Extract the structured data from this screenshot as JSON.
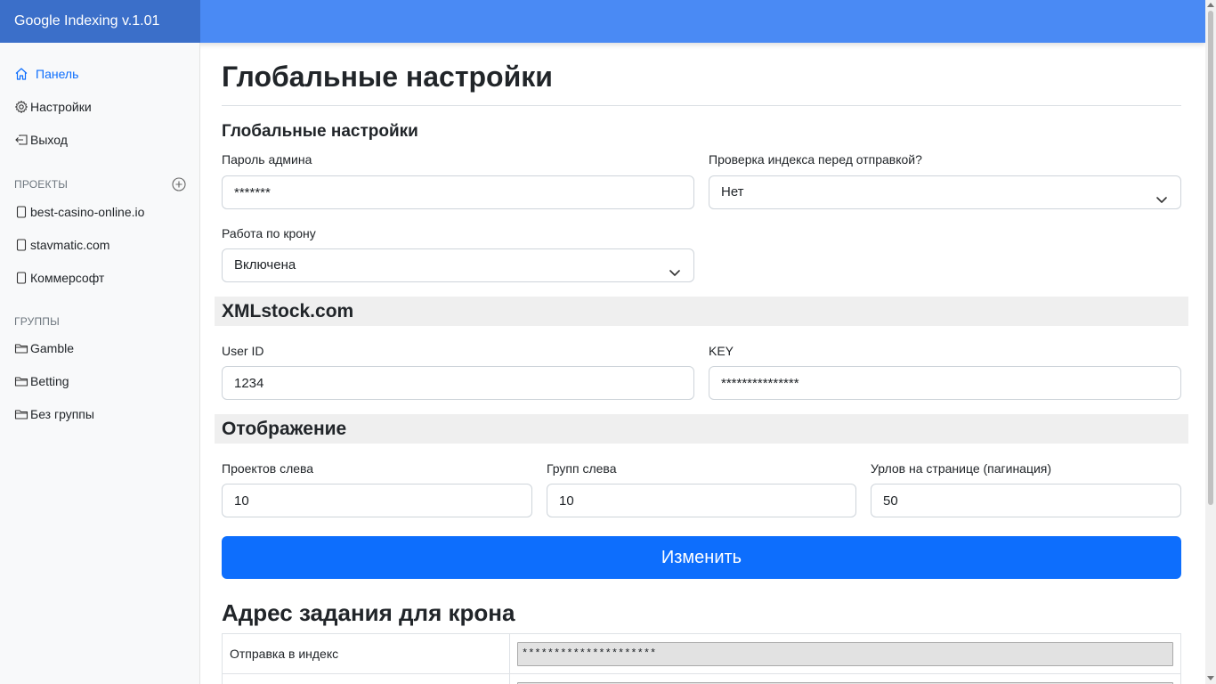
{
  "app": {
    "title": "Google Indexing v.1.01"
  },
  "sidebar": {
    "nav": [
      {
        "label": "Панель",
        "icon": "home-icon",
        "active": true
      },
      {
        "label": "Настройки",
        "icon": "gear-icon"
      },
      {
        "label": "Выход",
        "icon": "logout-icon"
      }
    ],
    "projects_heading": "ПРОЕКТЫ",
    "projects": [
      {
        "label": "best-casino-online.io"
      },
      {
        "label": "stavmatic.com"
      },
      {
        "label": "Коммерсофт"
      }
    ],
    "groups_heading": "ГРУППЫ",
    "groups": [
      {
        "label": "Gamble"
      },
      {
        "label": "Betting"
      },
      {
        "label": "Без группы"
      }
    ]
  },
  "page": {
    "title": "Глобальные настройки"
  },
  "global": {
    "heading": "Глобальные настройки",
    "admin_password_label": "Пароль админа",
    "admin_password_value": "*******",
    "index_check_label": "Проверка индекса перед отправкой?",
    "index_check_value": "Нет",
    "cron_label": "Работа по крону",
    "cron_value": "Включена"
  },
  "xmlstock": {
    "heading": "XMLstock.com",
    "user_id_label": "User ID",
    "user_id_value": "1234",
    "key_label": "KEY",
    "key_value": "***************"
  },
  "display": {
    "heading": "Отображение",
    "projects_left_label": "Проектов слева",
    "projects_left_value": "10",
    "groups_left_label": "Групп слева",
    "groups_left_value": "10",
    "urls_per_page_label": "Урлов на странице (пагинация)",
    "urls_per_page_value": "50"
  },
  "actions": {
    "submit_label": "Изменить"
  },
  "cron_section": {
    "heading": "Адрес задания для крона",
    "rows": [
      {
        "name": "Отправка в индекс",
        "value": "*********************"
      },
      {
        "name": "",
        "value": ""
      }
    ]
  }
}
